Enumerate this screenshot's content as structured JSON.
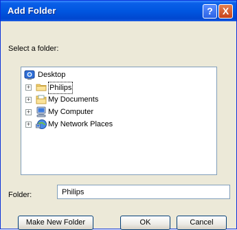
{
  "window": {
    "title": "Add Folder"
  },
  "titlebar": {
    "help_symbol": "?",
    "close_symbol": "X"
  },
  "prompt": "Select a folder:",
  "tree": {
    "root": {
      "label": "Desktop",
      "icon": "desktop-icon"
    },
    "items": [
      {
        "label": "Philips",
        "icon": "folder-icon",
        "selected": true
      },
      {
        "label": "My Documents",
        "icon": "my-documents-icon"
      },
      {
        "label": "My Computer",
        "icon": "my-computer-icon"
      },
      {
        "label": "My Network Places",
        "icon": "network-places-icon"
      }
    ],
    "expand_symbol": "+"
  },
  "folder_field": {
    "label": "Folder:",
    "value": "Philips"
  },
  "buttons": {
    "make_new_folder": "Make New Folder",
    "ok": "OK",
    "cancel": "Cancel"
  }
}
